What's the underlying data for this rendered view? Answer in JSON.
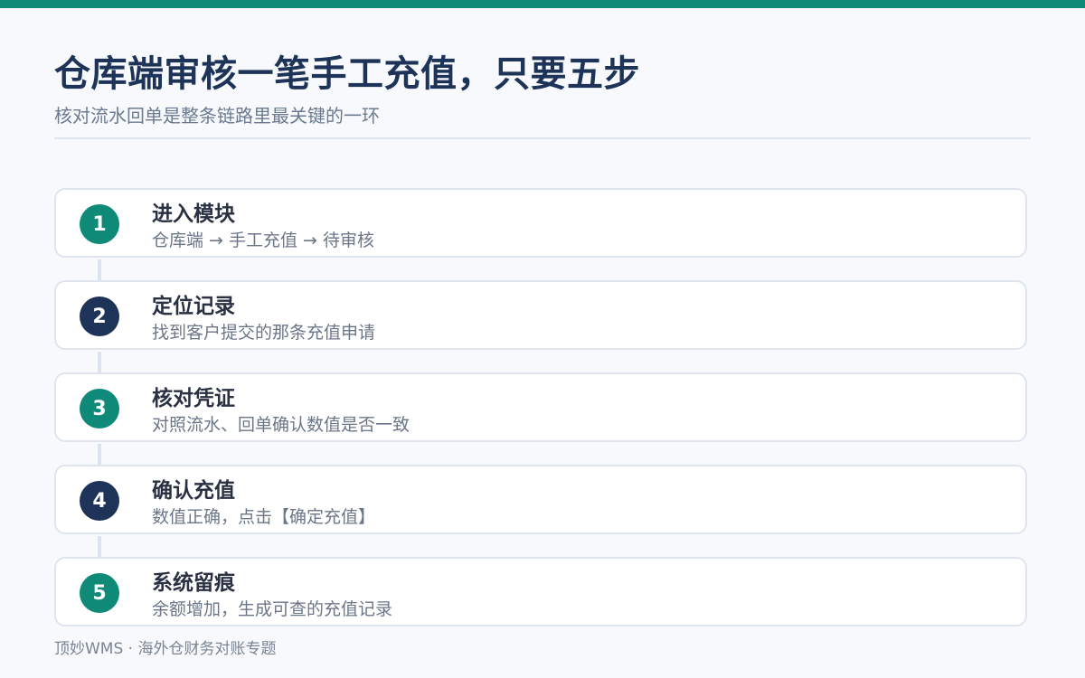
{
  "header": {
    "title": "仓库端审核一笔手工充值，只要五步",
    "subtitle": "核对流水回单是整条链路里最关键的一环"
  },
  "colors": {
    "accent_teal": "#0f8a78",
    "accent_navy": "#1e3358"
  },
  "steps": [
    {
      "number": "1",
      "title": "进入模块",
      "desc": "仓库端 → 手工充值 → 待审核",
      "badge_color": "teal"
    },
    {
      "number": "2",
      "title": "定位记录",
      "desc": "找到客户提交的那条充值申请",
      "badge_color": "navy"
    },
    {
      "number": "3",
      "title": "核对凭证",
      "desc": "对照流水、回单确认数值是否一致",
      "badge_color": "teal"
    },
    {
      "number": "4",
      "title": "确认充值",
      "desc": "数值正确，点击【确定充值】",
      "badge_color": "navy"
    },
    {
      "number": "5",
      "title": "系统留痕",
      "desc": "余额增加，生成可查的充值记录",
      "badge_color": "teal"
    }
  ],
  "footer": {
    "text": "顶妙WMS · 海外仓财务对账专题"
  }
}
